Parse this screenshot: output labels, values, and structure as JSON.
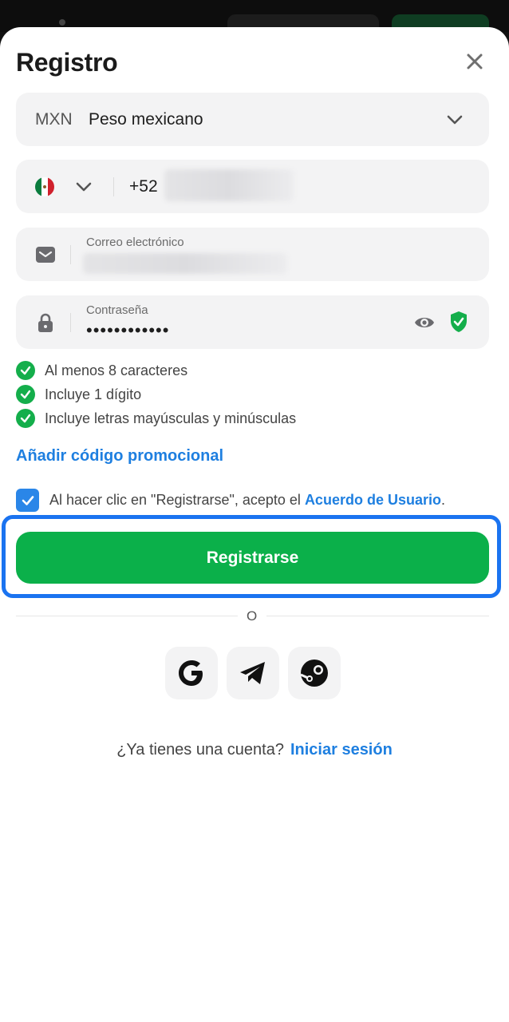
{
  "header": {
    "title": "Registro"
  },
  "currency": {
    "code": "MXN",
    "name": "Peso mexicano"
  },
  "phone": {
    "prefix": "+52",
    "country_flag": "mexico-flag"
  },
  "email": {
    "label": "Correo electrónico"
  },
  "password": {
    "label": "Contraseña",
    "masked_value": "••••••••••••"
  },
  "rules": [
    {
      "text": "Al menos 8 caracteres"
    },
    {
      "text": "Incluye 1 dígito"
    },
    {
      "text": "Incluye letras mayúsculas y minúsculas"
    }
  ],
  "promo_label": "Añadir código promocional",
  "agreement": {
    "text": "Al hacer clic en \"Registrarse\", acepto el",
    "link": "Acuerdo de Usuario",
    "end": "."
  },
  "cta_label": "Registrarse",
  "or_label": "O",
  "social": [
    {
      "icon": "google-icon"
    },
    {
      "icon": "telegram-icon"
    },
    {
      "icon": "steam-icon"
    }
  ],
  "footer": {
    "question": "¿Ya tienes una cuenta?",
    "link": "Iniciar sesión"
  },
  "colors": {
    "brand_green": "#0bb04a",
    "link_blue": "#1e7fe0",
    "focus_blue": "#1a73f0"
  }
}
